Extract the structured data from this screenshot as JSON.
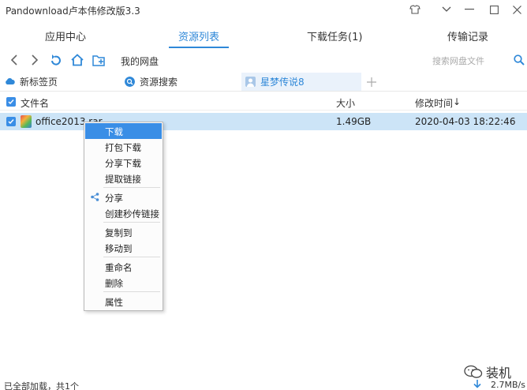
{
  "window": {
    "title": "Pandownload卢本伟修改版3.3"
  },
  "topnav": {
    "tabs": [
      {
        "label": "应用中心"
      },
      {
        "label": "资源列表"
      },
      {
        "label": "下载任务(1)"
      },
      {
        "label": "传输记录"
      }
    ]
  },
  "toolbar": {
    "path": "我的网盘",
    "search_placeholder": "搜索网盘文件"
  },
  "browser_tabs": [
    {
      "label": "新标签页"
    },
    {
      "label": "资源搜索"
    },
    {
      "label": "星梦传说8"
    }
  ],
  "columns": {
    "name": "文件名",
    "size": "大小",
    "modified": "修改时间",
    "sort_arrow": "↓"
  },
  "files": [
    {
      "name": "office2013.rar",
      "size": "1.49GB",
      "modified": "2020-04-03 18:22:46"
    }
  ],
  "context_menu": {
    "items": [
      {
        "label": "下载"
      },
      {
        "label": "打包下载"
      },
      {
        "label": "分享下载"
      },
      {
        "label": "提取链接"
      },
      {
        "label": "分享"
      },
      {
        "label": "创建秒传链接"
      },
      {
        "label": "复制到"
      },
      {
        "label": "移动到"
      },
      {
        "label": "重命名"
      },
      {
        "label": "删除"
      },
      {
        "label": "属性"
      }
    ]
  },
  "status": {
    "left": "已全部加载，共1个",
    "speed": "2.7MB/s",
    "watermark": "装机"
  },
  "colors": {
    "accent": "#2f88d8",
    "selection": "#cce4f7",
    "menu_highlight": "#3a8ee6"
  }
}
